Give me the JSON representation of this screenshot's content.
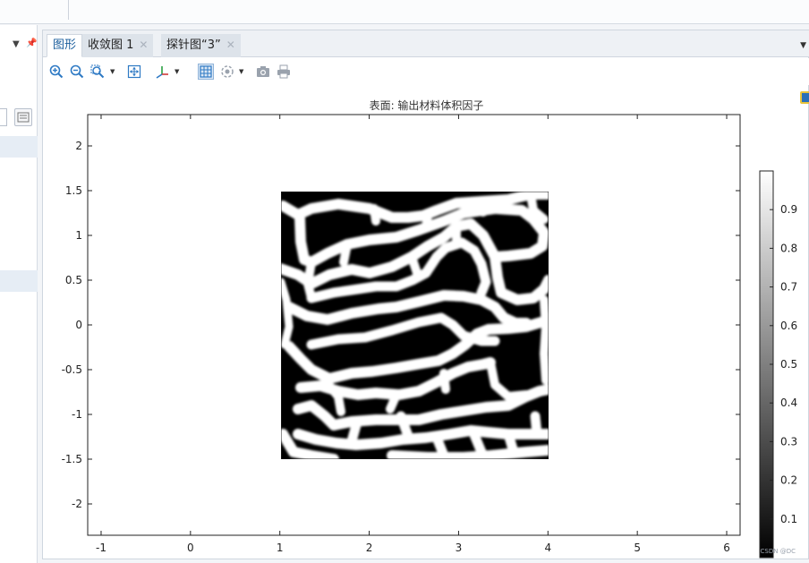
{
  "window": {
    "tabs": [
      {
        "label": "图形",
        "active": true,
        "closable": false
      },
      {
        "label": "收敛图 1",
        "active": false,
        "closable": true
      },
      {
        "label": "探针图“3”",
        "active": false,
        "closable": true
      }
    ],
    "toolbar_icons": [
      "zoom-in-icon",
      "zoom-out-icon",
      "zoom-box-icon",
      "zoom-extents-icon",
      "axis-orientation-icon",
      "grid-toggle-icon",
      "scene-light-icon",
      "snapshot-camera-icon",
      "print-icon"
    ]
  },
  "plot": {
    "title": "表面: 输出材料体积因子",
    "watermark": "CSDN @DC",
    "colormap": "grayscale",
    "accent": "#1a5d9c"
  },
  "chart_data": {
    "type": "heatmap",
    "title": "表面: 输出材料体积因子",
    "x_ticks": [
      "-1",
      "0",
      "1",
      "2",
      "3",
      "4",
      "5",
      "6"
    ],
    "y_ticks": [
      "2",
      "1.5",
      "1",
      "0.5",
      "0",
      "-0.5",
      "-1",
      "-1.5",
      "-2"
    ],
    "xlim": [
      -1.15,
      6.15
    ],
    "ylim": [
      -2.35,
      2.35
    ],
    "domain_x": [
      1,
      4
    ],
    "domain_y": [
      -1.5,
      1.5
    ],
    "colorbar_ticks": [
      "0.9",
      "0.8",
      "0.7",
      "0.6",
      "0.5",
      "0.4",
      "0.3",
      "0.2",
      "0.1"
    ],
    "colorbar_range": [
      0,
      1
    ]
  }
}
